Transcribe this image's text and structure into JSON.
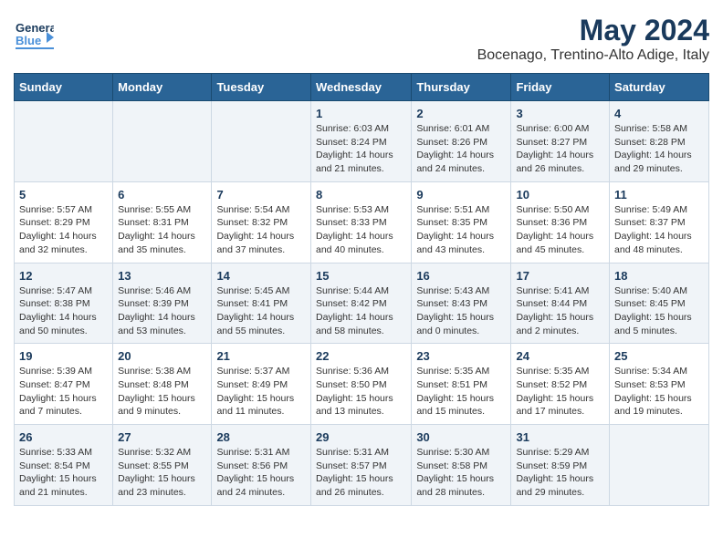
{
  "header": {
    "logo_line1": "General",
    "logo_line2": "Blue",
    "month_year": "May 2024",
    "location": "Bocenago, Trentino-Alto Adige, Italy"
  },
  "weekdays": [
    "Sunday",
    "Monday",
    "Tuesday",
    "Wednesday",
    "Thursday",
    "Friday",
    "Saturday"
  ],
  "weeks": [
    [
      {
        "day": "",
        "text": ""
      },
      {
        "day": "",
        "text": ""
      },
      {
        "day": "",
        "text": ""
      },
      {
        "day": "1",
        "text": "Sunrise: 6:03 AM\nSunset: 8:24 PM\nDaylight: 14 hours\nand 21 minutes."
      },
      {
        "day": "2",
        "text": "Sunrise: 6:01 AM\nSunset: 8:26 PM\nDaylight: 14 hours\nand 24 minutes."
      },
      {
        "day": "3",
        "text": "Sunrise: 6:00 AM\nSunset: 8:27 PM\nDaylight: 14 hours\nand 26 minutes."
      },
      {
        "day": "4",
        "text": "Sunrise: 5:58 AM\nSunset: 8:28 PM\nDaylight: 14 hours\nand 29 minutes."
      }
    ],
    [
      {
        "day": "5",
        "text": "Sunrise: 5:57 AM\nSunset: 8:29 PM\nDaylight: 14 hours\nand 32 minutes."
      },
      {
        "day": "6",
        "text": "Sunrise: 5:55 AM\nSunset: 8:31 PM\nDaylight: 14 hours\nand 35 minutes."
      },
      {
        "day": "7",
        "text": "Sunrise: 5:54 AM\nSunset: 8:32 PM\nDaylight: 14 hours\nand 37 minutes."
      },
      {
        "day": "8",
        "text": "Sunrise: 5:53 AM\nSunset: 8:33 PM\nDaylight: 14 hours\nand 40 minutes."
      },
      {
        "day": "9",
        "text": "Sunrise: 5:51 AM\nSunset: 8:35 PM\nDaylight: 14 hours\nand 43 minutes."
      },
      {
        "day": "10",
        "text": "Sunrise: 5:50 AM\nSunset: 8:36 PM\nDaylight: 14 hours\nand 45 minutes."
      },
      {
        "day": "11",
        "text": "Sunrise: 5:49 AM\nSunset: 8:37 PM\nDaylight: 14 hours\nand 48 minutes."
      }
    ],
    [
      {
        "day": "12",
        "text": "Sunrise: 5:47 AM\nSunset: 8:38 PM\nDaylight: 14 hours\nand 50 minutes."
      },
      {
        "day": "13",
        "text": "Sunrise: 5:46 AM\nSunset: 8:39 PM\nDaylight: 14 hours\nand 53 minutes."
      },
      {
        "day": "14",
        "text": "Sunrise: 5:45 AM\nSunset: 8:41 PM\nDaylight: 14 hours\nand 55 minutes."
      },
      {
        "day": "15",
        "text": "Sunrise: 5:44 AM\nSunset: 8:42 PM\nDaylight: 14 hours\nand 58 minutes."
      },
      {
        "day": "16",
        "text": "Sunrise: 5:43 AM\nSunset: 8:43 PM\nDaylight: 15 hours\nand 0 minutes."
      },
      {
        "day": "17",
        "text": "Sunrise: 5:41 AM\nSunset: 8:44 PM\nDaylight: 15 hours\nand 2 minutes."
      },
      {
        "day": "18",
        "text": "Sunrise: 5:40 AM\nSunset: 8:45 PM\nDaylight: 15 hours\nand 5 minutes."
      }
    ],
    [
      {
        "day": "19",
        "text": "Sunrise: 5:39 AM\nSunset: 8:47 PM\nDaylight: 15 hours\nand 7 minutes."
      },
      {
        "day": "20",
        "text": "Sunrise: 5:38 AM\nSunset: 8:48 PM\nDaylight: 15 hours\nand 9 minutes."
      },
      {
        "day": "21",
        "text": "Sunrise: 5:37 AM\nSunset: 8:49 PM\nDaylight: 15 hours\nand 11 minutes."
      },
      {
        "day": "22",
        "text": "Sunrise: 5:36 AM\nSunset: 8:50 PM\nDaylight: 15 hours\nand 13 minutes."
      },
      {
        "day": "23",
        "text": "Sunrise: 5:35 AM\nSunset: 8:51 PM\nDaylight: 15 hours\nand 15 minutes."
      },
      {
        "day": "24",
        "text": "Sunrise: 5:35 AM\nSunset: 8:52 PM\nDaylight: 15 hours\nand 17 minutes."
      },
      {
        "day": "25",
        "text": "Sunrise: 5:34 AM\nSunset: 8:53 PM\nDaylight: 15 hours\nand 19 minutes."
      }
    ],
    [
      {
        "day": "26",
        "text": "Sunrise: 5:33 AM\nSunset: 8:54 PM\nDaylight: 15 hours\nand 21 minutes."
      },
      {
        "day": "27",
        "text": "Sunrise: 5:32 AM\nSunset: 8:55 PM\nDaylight: 15 hours\nand 23 minutes."
      },
      {
        "day": "28",
        "text": "Sunrise: 5:31 AM\nSunset: 8:56 PM\nDaylight: 15 hours\nand 24 minutes."
      },
      {
        "day": "29",
        "text": "Sunrise: 5:31 AM\nSunset: 8:57 PM\nDaylight: 15 hours\nand 26 minutes."
      },
      {
        "day": "30",
        "text": "Sunrise: 5:30 AM\nSunset: 8:58 PM\nDaylight: 15 hours\nand 28 minutes."
      },
      {
        "day": "31",
        "text": "Sunrise: 5:29 AM\nSunset: 8:59 PM\nDaylight: 15 hours\nand 29 minutes."
      },
      {
        "day": "",
        "text": ""
      }
    ]
  ]
}
